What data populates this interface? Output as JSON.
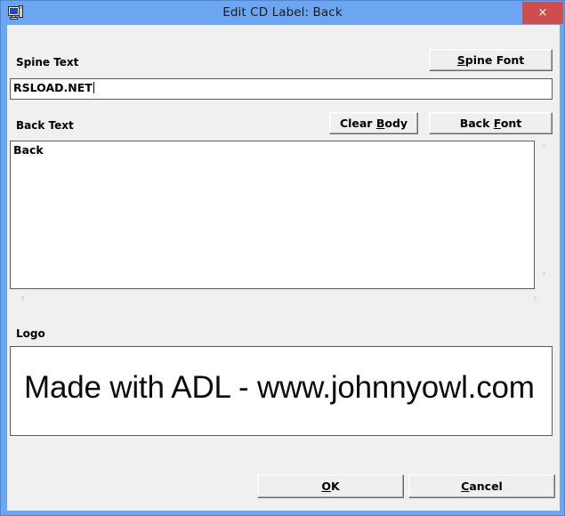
{
  "window": {
    "title": "Edit CD Label: Back",
    "icon": "cd-label-window-icon",
    "close_label": "×",
    "titlebar_color": "#6ca6f0",
    "close_button_color": "#cf4d4d",
    "client_background": "#f0f0f0"
  },
  "spine": {
    "label": "Spine Text",
    "font_button": {
      "label": "Spine Font",
      "accel": "S"
    },
    "input": {
      "value": "RSLOAD.NET",
      "placeholder": ""
    }
  },
  "back": {
    "label": "Back Text",
    "clear_button": {
      "label": "Clear Body",
      "accel": "B"
    },
    "font_button": {
      "label": "Back Font",
      "accel": "F"
    },
    "textarea": {
      "value": "Back",
      "placeholder": ""
    },
    "scroll": {
      "up_icon": "chevron-up-icon",
      "down_icon": "chevron-down-icon",
      "left_icon": "chevron-left-icon",
      "right_icon": "chevron-right-icon",
      "up_glyph": "˄",
      "down_glyph": "˅",
      "left_glyph": "‹",
      "right_glyph": "›"
    }
  },
  "logo": {
    "label": "Logo",
    "preview_text": "Made with ADL - www.johnnyowl.com"
  },
  "footer": {
    "ok": {
      "label": "OK",
      "accel": "O"
    },
    "cancel": {
      "label": "Cancel",
      "accel": "C"
    }
  }
}
